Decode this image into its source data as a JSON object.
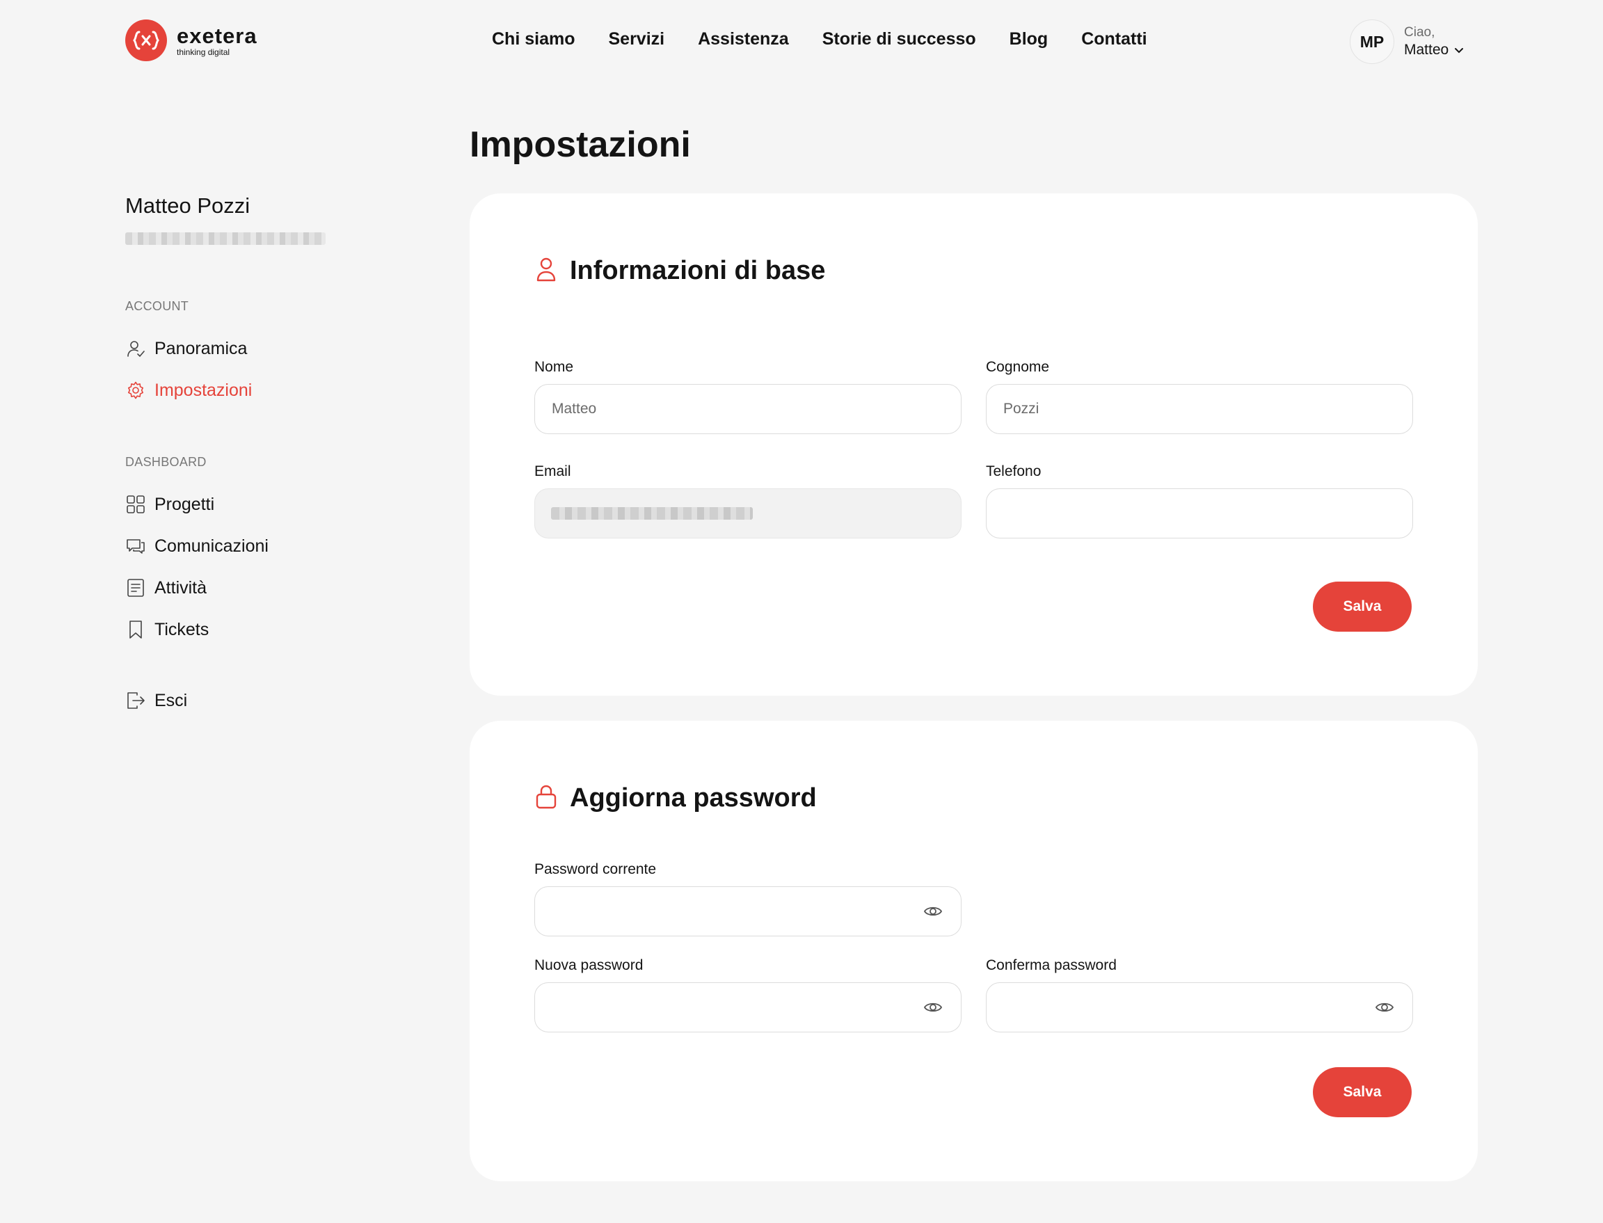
{
  "colors": {
    "accent": "#e5433a",
    "background": "#f5f5f5",
    "card": "#ffffff",
    "text": "#141414"
  },
  "brand": {
    "name": "exetera",
    "tagline": "thinking digital"
  },
  "nav": {
    "items": [
      {
        "label": "Chi siamo"
      },
      {
        "label": "Servizi"
      },
      {
        "label": "Assistenza"
      },
      {
        "label": "Storie di successo"
      },
      {
        "label": "Blog"
      },
      {
        "label": "Contatti"
      }
    ]
  },
  "user": {
    "initials": "MP",
    "greeting": "Ciao,",
    "name": "Matteo"
  },
  "sidebar": {
    "profile_name": "Matteo Pozzi",
    "account_label": "ACCOUNT",
    "account_items": [
      {
        "label": "Panoramica",
        "icon": "user-check-icon"
      },
      {
        "label": "Impostazioni",
        "icon": "gear-icon",
        "active": true
      }
    ],
    "dashboard_label": "DASHBOARD",
    "dashboard_items": [
      {
        "label": "Progetti",
        "icon": "grid-icon"
      },
      {
        "label": "Comunicazioni",
        "icon": "chat-icon"
      },
      {
        "label": "Attività",
        "icon": "document-icon"
      },
      {
        "label": "Tickets",
        "icon": "bookmark-icon"
      }
    ],
    "logout_label": "Esci"
  },
  "page_title": "Impostazioni",
  "basic_info": {
    "title": "Informazioni di base",
    "first_name_label": "Nome",
    "first_name_placeholder": "Matteo",
    "last_name_label": "Cognome",
    "last_name_placeholder": "Pozzi",
    "email_label": "Email",
    "phone_label": "Telefono",
    "phone_value": "",
    "save_label": "Salva"
  },
  "password": {
    "title": "Aggiorna password",
    "current_label": "Password corrente",
    "new_label": "Nuova password",
    "confirm_label": "Conferma password",
    "save_label": "Salva"
  }
}
